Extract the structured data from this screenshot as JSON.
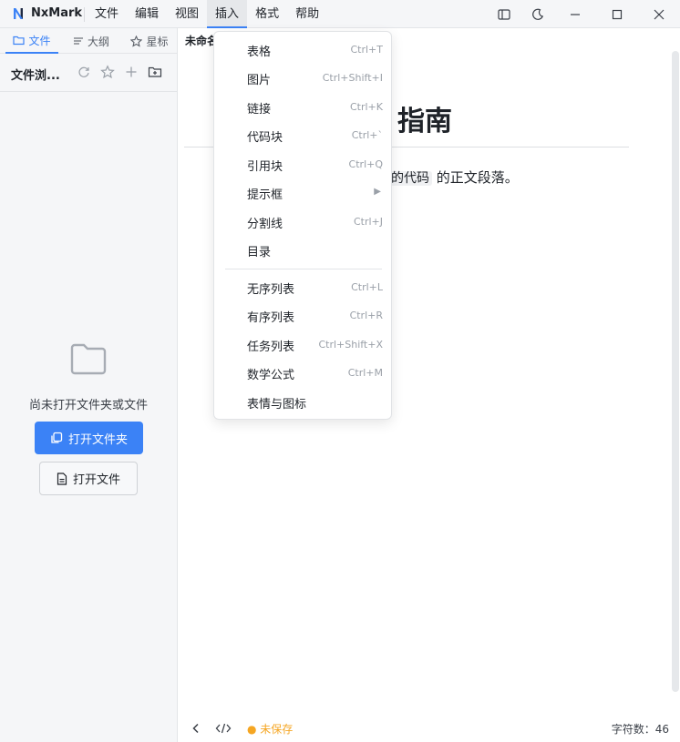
{
  "app": {
    "name": "NxMark"
  },
  "menubar": [
    "文件",
    "编辑",
    "视图",
    "插入",
    "格式",
    "帮助"
  ],
  "sidebar": {
    "tabs": [
      {
        "label": "文件",
        "icon": "folder-icon",
        "active": true
      },
      {
        "label": "大纲",
        "icon": "outline-icon",
        "active": false
      },
      {
        "label": "星标",
        "icon": "star-icon",
        "active": false
      }
    ],
    "explorer_title": "文件浏...",
    "empty_text": "尚未打开文件夹或文件",
    "open_folder_label": "打开文件夹",
    "open_file_label": "打开文件"
  },
  "editor": {
    "tab_title": "未命名",
    "heading_visible": "指南",
    "paragraph_code": "的代码",
    "paragraph_rest": " 的正文段落。"
  },
  "insert_menu": {
    "items": [
      {
        "label": "表格",
        "shortcut": "Ctrl+T"
      },
      {
        "label": "图片",
        "shortcut": "Ctrl+Shift+I"
      },
      {
        "label": "链接",
        "shortcut": "Ctrl+K"
      },
      {
        "label": "代码块",
        "shortcut": "Ctrl+`"
      },
      {
        "label": "引用块",
        "shortcut": "Ctrl+Q"
      },
      {
        "label": "提示框",
        "submenu": "▶"
      },
      {
        "label": "分割线",
        "shortcut": "Ctrl+J"
      },
      {
        "label": "目录",
        "shortcut": ""
      },
      {
        "label": "无序列表",
        "shortcut": "Ctrl+L"
      },
      {
        "label": "有序列表",
        "shortcut": "Ctrl+R"
      },
      {
        "label": "任务列表",
        "shortcut": "Ctrl+Shift+X"
      },
      {
        "label": "数学公式",
        "shortcut": "Ctrl+M"
      },
      {
        "label": "表情与图标",
        "shortcut": ""
      }
    ]
  },
  "statusbar": {
    "unsaved": "● 未保存",
    "wordcount": "字符数：46"
  },
  "colors": {
    "accent": "#3b82f6",
    "warning": "#f5a623"
  }
}
